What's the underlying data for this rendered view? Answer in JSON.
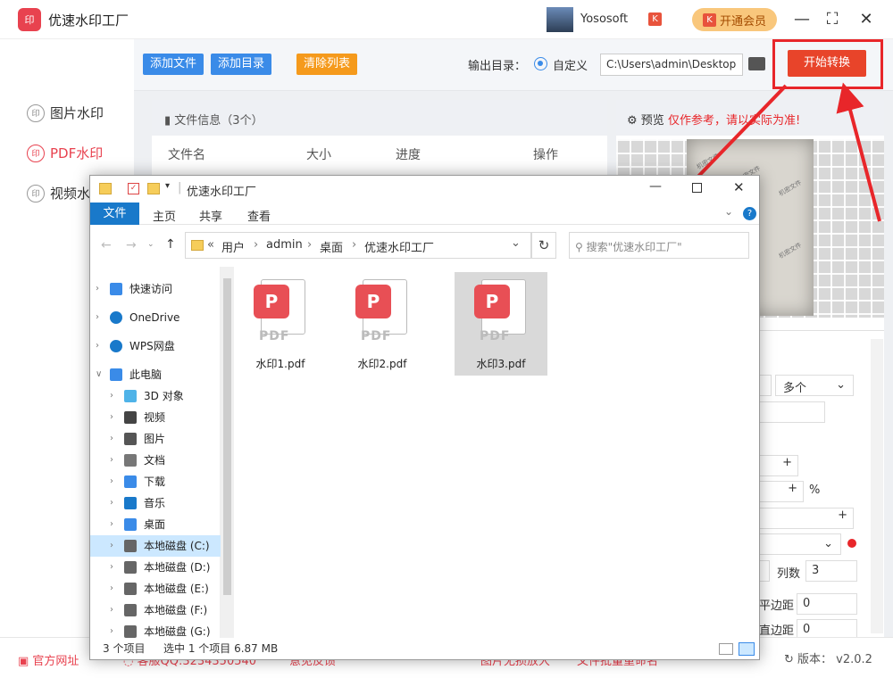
{
  "app": {
    "name": "优速水印工厂",
    "logo_text": "印",
    "username": "Yososoft",
    "vip_label": "开通会员"
  },
  "nav": {
    "items": [
      {
        "label": "图片水印",
        "icon": "印"
      },
      {
        "label": "PDF水印",
        "icon": "印"
      },
      {
        "label": "视频水印",
        "icon": "印"
      }
    ]
  },
  "toolbar": {
    "add_file": "添加文件",
    "add_dir": "添加目录",
    "clear_list": "清除列表",
    "output_label": "输出目录：",
    "custom_label": "自定义",
    "output_path": "C:\\Users\\admin\\Desktop",
    "start": "开始转换"
  },
  "filelist": {
    "header": "文件信息（3个）",
    "columns": [
      "文件名",
      "大小",
      "进度",
      "操作"
    ]
  },
  "preview": {
    "label": "预览",
    "warning": "仅作参考，请以实际为准!",
    "watermark_text": "机密文件"
  },
  "settings": {
    "multi": "多个",
    "percent": "%",
    "cols_label": "列数",
    "cols_value": "3",
    "hmargin_label": "平边距",
    "hmargin_value": "0",
    "vmargin_label": "直边距",
    "vmargin_value": "0",
    "plus": "+"
  },
  "footer": {
    "links": [
      "官方网址",
      "客服QQ:3234350540",
      "意见反馈",
      "图片无损放大",
      "文件批量重命名"
    ],
    "version": "版本：  v2.0.2"
  },
  "explorer": {
    "title": "优速水印工厂",
    "ribbon": {
      "file": "文件",
      "tabs": [
        "主页",
        "共享",
        "查看"
      ]
    },
    "breadcrumb": [
      "用户",
      "admin",
      "桌面",
      "优速水印工厂"
    ],
    "search_placeholder": "搜索\"优速水印工厂\"",
    "nav": [
      {
        "label": "快速访问",
        "icon": "star"
      },
      {
        "label": "OneDrive",
        "icon": "cloud"
      },
      {
        "label": "WPS网盘",
        "icon": "cloud"
      },
      {
        "label": "此电脑",
        "icon": "pc"
      },
      {
        "label": "3D 对象",
        "icon": "cube"
      },
      {
        "label": "视频",
        "icon": "video"
      },
      {
        "label": "图片",
        "icon": "image"
      },
      {
        "label": "文档",
        "icon": "doc"
      },
      {
        "label": "下载",
        "icon": "download"
      },
      {
        "label": "音乐",
        "icon": "music"
      },
      {
        "label": "桌面",
        "icon": "desktop"
      },
      {
        "label": "本地磁盘 (C:)",
        "icon": "disk"
      },
      {
        "label": "本地磁盘 (D:)",
        "icon": "disk"
      },
      {
        "label": "本地磁盘 (E:)",
        "icon": "disk"
      },
      {
        "label": "本地磁盘 (F:)",
        "icon": "disk"
      },
      {
        "label": "本地磁盘 (G:)",
        "icon": "disk"
      }
    ],
    "files": [
      {
        "name": "水印1.pdf",
        "badge": "PDF"
      },
      {
        "name": "水印2.pdf",
        "badge": "PDF"
      },
      {
        "name": "水印3.pdf",
        "badge": "PDF"
      }
    ],
    "status": {
      "count": "3 个项目",
      "selection": "选中 1 个项目 6.87 MB"
    }
  },
  "colors": {
    "accent_red": "#e8424f",
    "start_button": "#e8442a",
    "highlight_frame": "#e8262a",
    "blue_button": "#3a8be8",
    "orange_button": "#f59a1c"
  }
}
